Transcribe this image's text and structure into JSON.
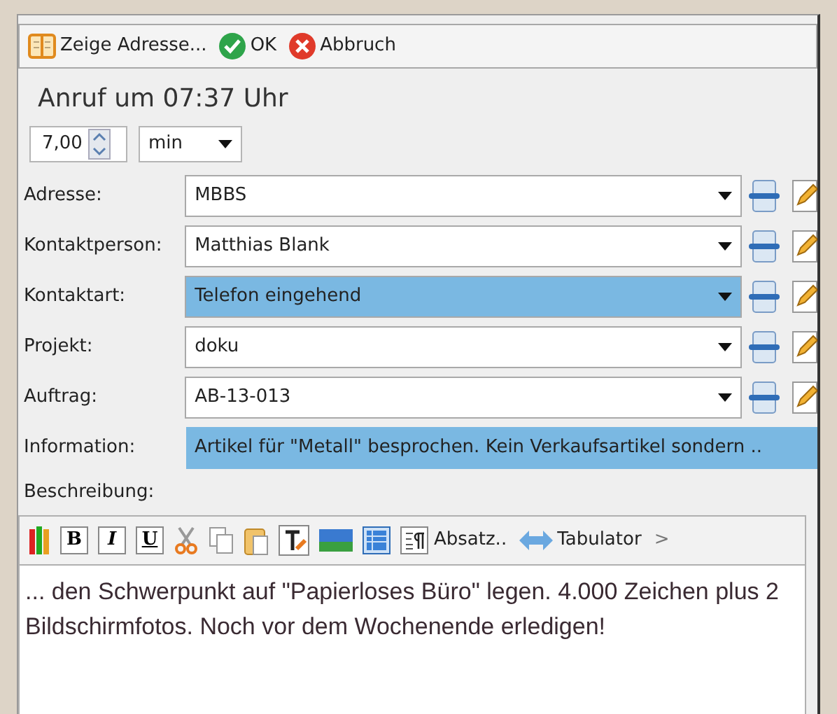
{
  "toolbar": {
    "show_address": "Zeige Adresse...",
    "ok": "OK",
    "cancel": "Abbruch"
  },
  "title": "Anruf um 07:37 Uhr",
  "duration": {
    "value": "7,00",
    "unit": "min"
  },
  "fields": [
    {
      "label": "Adresse:",
      "value": "MBBS",
      "kind": "combo",
      "selected": false
    },
    {
      "label": "Kontaktperson:",
      "value": "Matthias Blank",
      "kind": "combo",
      "selected": false
    },
    {
      "label": "Kontaktart:",
      "value": "Telefon eingehend",
      "kind": "combo",
      "selected": true
    },
    {
      "label": "Projekt:",
      "value": "doku",
      "kind": "combo",
      "selected": false
    },
    {
      "label": "Auftrag:",
      "value": "AB-13-013",
      "kind": "combo",
      "selected": false
    },
    {
      "label": "Information:",
      "value": "Artikel für \"Metall\" besprochen. Kein Verkaufsartikel sondern ..",
      "kind": "info",
      "selected": true
    }
  ],
  "description_label": "Beschreibung:",
  "editor_toolbar": {
    "format_buttons": [
      "B",
      "I",
      "U"
    ],
    "paragraph": "Absatz..",
    "tab": "Tabulator",
    "more": ">"
  },
  "description_text": "... den Schwerpunkt auf \"Papierloses Büro\" legen. 4.000 Zeichen plus 2 Bildschirmfotos. Noch vor dem Wochenende erledigen!"
}
